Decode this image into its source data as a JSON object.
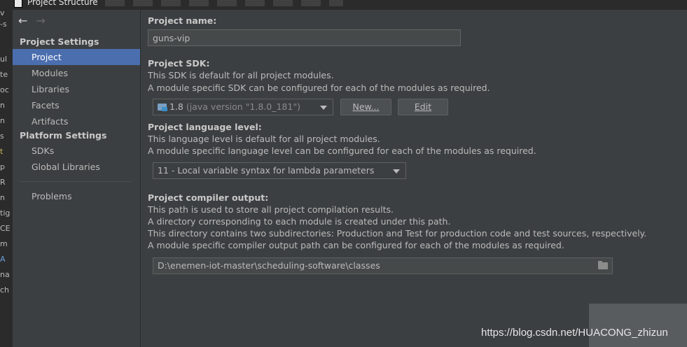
{
  "window": {
    "title": "Project Structure"
  },
  "ide_strip": [
    "v",
    "-s",
    "ul",
    "te",
    "oc",
    "n",
    "n",
    "s",
    "t",
    "p",
    "R",
    "n",
    "tig",
    "CE",
    "m",
    "A",
    "na",
    "ch"
  ],
  "sidebar": {
    "project_settings_heading": "Project Settings",
    "project_items": [
      {
        "label": "Project",
        "selected": true
      },
      {
        "label": "Modules"
      },
      {
        "label": "Libraries"
      },
      {
        "label": "Facets"
      },
      {
        "label": "Artifacts"
      }
    ],
    "platform_settings_heading": "Platform Settings",
    "platform_items": [
      {
        "label": "SDKs"
      },
      {
        "label": "Global Libraries"
      }
    ],
    "problems_label": "Problems"
  },
  "main": {
    "name": {
      "label": "Project name:",
      "value": "guns-vip"
    },
    "sdk": {
      "label": "Project SDK:",
      "desc1": "This SDK is default for all project modules.",
      "desc2": "A module specific SDK can be configured for each of the modules as required.",
      "selected_name": "1.8",
      "selected_detail": "(java version \"1.8.0_181\")",
      "new_button": "New...",
      "edit_button": "Edit"
    },
    "language": {
      "label": "Project language level:",
      "desc1": "This language level is default for all project modules.",
      "desc2": "A module specific language level can be configured for each of the modules as required.",
      "selected": "11 - Local variable syntax for lambda parameters"
    },
    "compiler": {
      "label": "Project compiler output:",
      "desc1": "This path is used to store all project compilation results.",
      "desc2": "A directory corresponding to each module is created under this path.",
      "desc3": "This directory contains two subdirectories: Production and Test for production code and test sources, respectively.",
      "desc4": "A module specific compiler output path can be configured for each of the modules as required.",
      "path": "D:\\enemen-iot-master\\scheduling-software\\classes"
    }
  },
  "watermark": "https://blog.csdn.net/HUACONG_zhizun",
  "colors": {
    "background": "#3c3f41",
    "selection": "#4b6eaf",
    "text": "#bbbbbb"
  }
}
